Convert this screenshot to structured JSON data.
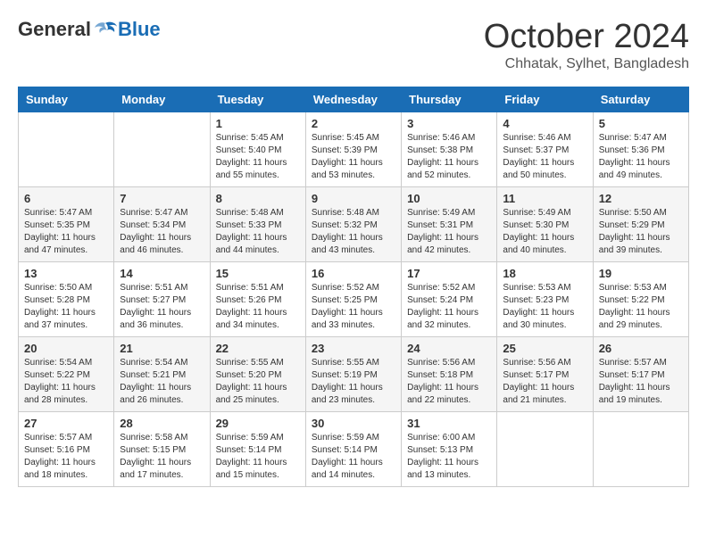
{
  "header": {
    "logo": {
      "general": "General",
      "blue": "Blue"
    },
    "title": "October 2024",
    "subtitle": "Chhatak, Sylhet, Bangladesh"
  },
  "calendar": {
    "days_of_week": [
      "Sunday",
      "Monday",
      "Tuesday",
      "Wednesday",
      "Thursday",
      "Friday",
      "Saturday"
    ],
    "weeks": [
      [
        {
          "day": "",
          "info": ""
        },
        {
          "day": "",
          "info": ""
        },
        {
          "day": "1",
          "info": "Sunrise: 5:45 AM\nSunset: 5:40 PM\nDaylight: 11 hours and 55 minutes."
        },
        {
          "day": "2",
          "info": "Sunrise: 5:45 AM\nSunset: 5:39 PM\nDaylight: 11 hours and 53 minutes."
        },
        {
          "day": "3",
          "info": "Sunrise: 5:46 AM\nSunset: 5:38 PM\nDaylight: 11 hours and 52 minutes."
        },
        {
          "day": "4",
          "info": "Sunrise: 5:46 AM\nSunset: 5:37 PM\nDaylight: 11 hours and 50 minutes."
        },
        {
          "day": "5",
          "info": "Sunrise: 5:47 AM\nSunset: 5:36 PM\nDaylight: 11 hours and 49 minutes."
        }
      ],
      [
        {
          "day": "6",
          "info": "Sunrise: 5:47 AM\nSunset: 5:35 PM\nDaylight: 11 hours and 47 minutes."
        },
        {
          "day": "7",
          "info": "Sunrise: 5:47 AM\nSunset: 5:34 PM\nDaylight: 11 hours and 46 minutes."
        },
        {
          "day": "8",
          "info": "Sunrise: 5:48 AM\nSunset: 5:33 PM\nDaylight: 11 hours and 44 minutes."
        },
        {
          "day": "9",
          "info": "Sunrise: 5:48 AM\nSunset: 5:32 PM\nDaylight: 11 hours and 43 minutes."
        },
        {
          "day": "10",
          "info": "Sunrise: 5:49 AM\nSunset: 5:31 PM\nDaylight: 11 hours and 42 minutes."
        },
        {
          "day": "11",
          "info": "Sunrise: 5:49 AM\nSunset: 5:30 PM\nDaylight: 11 hours and 40 minutes."
        },
        {
          "day": "12",
          "info": "Sunrise: 5:50 AM\nSunset: 5:29 PM\nDaylight: 11 hours and 39 minutes."
        }
      ],
      [
        {
          "day": "13",
          "info": "Sunrise: 5:50 AM\nSunset: 5:28 PM\nDaylight: 11 hours and 37 minutes."
        },
        {
          "day": "14",
          "info": "Sunrise: 5:51 AM\nSunset: 5:27 PM\nDaylight: 11 hours and 36 minutes."
        },
        {
          "day": "15",
          "info": "Sunrise: 5:51 AM\nSunset: 5:26 PM\nDaylight: 11 hours and 34 minutes."
        },
        {
          "day": "16",
          "info": "Sunrise: 5:52 AM\nSunset: 5:25 PM\nDaylight: 11 hours and 33 minutes."
        },
        {
          "day": "17",
          "info": "Sunrise: 5:52 AM\nSunset: 5:24 PM\nDaylight: 11 hours and 32 minutes."
        },
        {
          "day": "18",
          "info": "Sunrise: 5:53 AM\nSunset: 5:23 PM\nDaylight: 11 hours and 30 minutes."
        },
        {
          "day": "19",
          "info": "Sunrise: 5:53 AM\nSunset: 5:22 PM\nDaylight: 11 hours and 29 minutes."
        }
      ],
      [
        {
          "day": "20",
          "info": "Sunrise: 5:54 AM\nSunset: 5:22 PM\nDaylight: 11 hours and 28 minutes."
        },
        {
          "day": "21",
          "info": "Sunrise: 5:54 AM\nSunset: 5:21 PM\nDaylight: 11 hours and 26 minutes."
        },
        {
          "day": "22",
          "info": "Sunrise: 5:55 AM\nSunset: 5:20 PM\nDaylight: 11 hours and 25 minutes."
        },
        {
          "day": "23",
          "info": "Sunrise: 5:55 AM\nSunset: 5:19 PM\nDaylight: 11 hours and 23 minutes."
        },
        {
          "day": "24",
          "info": "Sunrise: 5:56 AM\nSunset: 5:18 PM\nDaylight: 11 hours and 22 minutes."
        },
        {
          "day": "25",
          "info": "Sunrise: 5:56 AM\nSunset: 5:17 PM\nDaylight: 11 hours and 21 minutes."
        },
        {
          "day": "26",
          "info": "Sunrise: 5:57 AM\nSunset: 5:17 PM\nDaylight: 11 hours and 19 minutes."
        }
      ],
      [
        {
          "day": "27",
          "info": "Sunrise: 5:57 AM\nSunset: 5:16 PM\nDaylight: 11 hours and 18 minutes."
        },
        {
          "day": "28",
          "info": "Sunrise: 5:58 AM\nSunset: 5:15 PM\nDaylight: 11 hours and 17 minutes."
        },
        {
          "day": "29",
          "info": "Sunrise: 5:59 AM\nSunset: 5:14 PM\nDaylight: 11 hours and 15 minutes."
        },
        {
          "day": "30",
          "info": "Sunrise: 5:59 AM\nSunset: 5:14 PM\nDaylight: 11 hours and 14 minutes."
        },
        {
          "day": "31",
          "info": "Sunrise: 6:00 AM\nSunset: 5:13 PM\nDaylight: 11 hours and 13 minutes."
        },
        {
          "day": "",
          "info": ""
        },
        {
          "day": "",
          "info": ""
        }
      ]
    ]
  }
}
